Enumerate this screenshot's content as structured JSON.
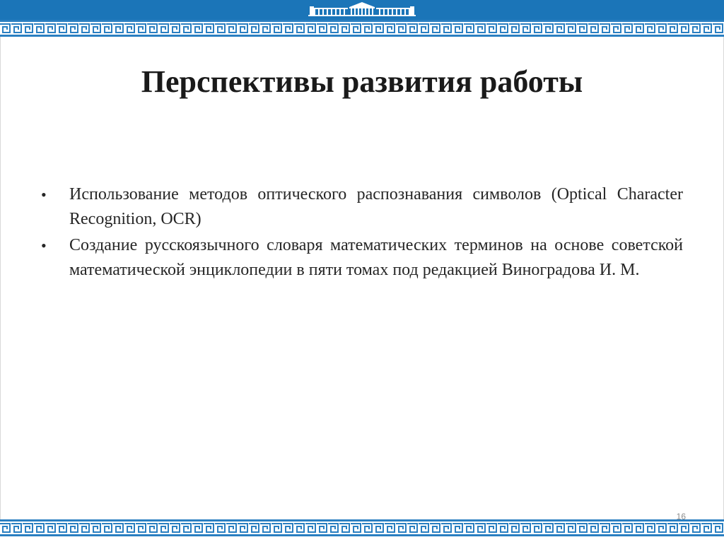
{
  "slide": {
    "title": "Перспективы развития работы",
    "bullets": [
      {
        "marker": "•",
        "text": "Использование методов оптического распознавания символов (Optical Character Recognition, OCR)"
      },
      {
        "marker": "•",
        "text": "Создание русскоязычного словаря математических терминов на основе советской математической энциклопедии в пяти томах под редакцией Виноградова И. М."
      }
    ],
    "page_number": "16"
  },
  "colors": {
    "header_blue": "#1b75b8",
    "border_blue": "#2a7fc1",
    "text": "#262626",
    "page_number": "#8c8c8c"
  },
  "icons": {
    "header_logo": "building-logo-icon",
    "border_pattern": "greek-key-border-pattern"
  }
}
